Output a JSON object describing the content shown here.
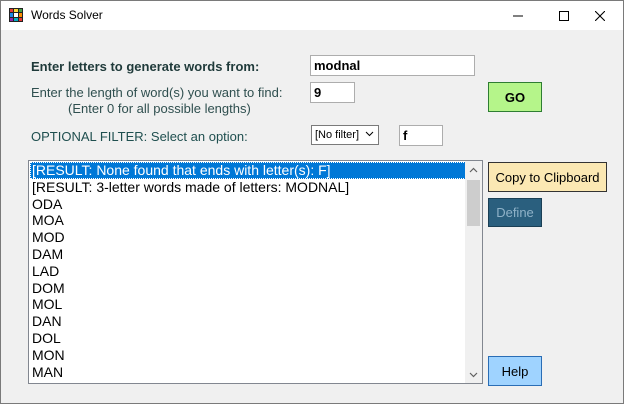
{
  "window": {
    "title": "Words Solver"
  },
  "form": {
    "letters_label": "Enter letters to generate words from:",
    "letters_value": "modnal",
    "length_label_line1": "Enter the length of word(s) you want to find:",
    "length_label_line2": "(Enter 0 for all possible lengths)",
    "length_value": "9",
    "filter_label": "OPTIONAL FILTER: Select an option:",
    "filter_selected": "[No filter]",
    "filter_value": "f"
  },
  "buttons": {
    "go": "GO",
    "copy": "Copy to Clipboard",
    "define": "Define",
    "help": "Help"
  },
  "results": {
    "items": [
      "[RESULT: None found that ends with letter(s): F]",
      "[RESULT: 3-letter words made of letters: MODNAL]",
      "ODA",
      "MOA",
      "MOD",
      "DAM",
      "LAD",
      "DOM",
      "MOL",
      "DAN",
      "DOL",
      "MON",
      "MAN"
    ],
    "selected_index": 0
  },
  "icons": {
    "app": "app-grid-icon",
    "minimize": "minimize-icon",
    "maximize": "maximize-icon",
    "close": "close-icon",
    "dropdown": "chevron-down-icon",
    "scroll_up": "scroll-up-arrow-icon",
    "scroll_down": "scroll-down-arrow-icon"
  },
  "colors": {
    "go_button": "#b5f58a",
    "copy_button": "#fbe8b3",
    "define_button": "#2a5f7e",
    "help_button": "#9fd3ff",
    "selection": "#0078d7"
  }
}
